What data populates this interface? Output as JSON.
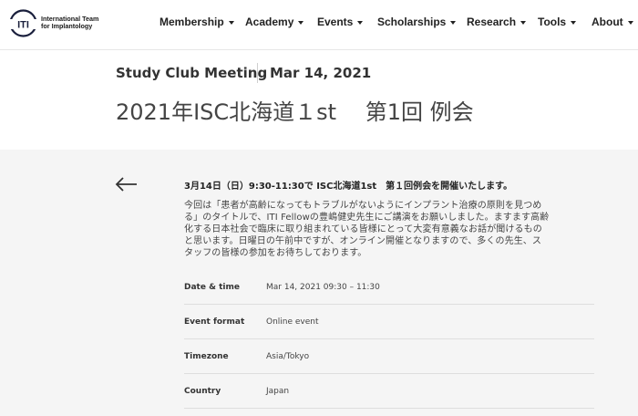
{
  "brand": {
    "mark": "ITI",
    "name_line1": "International Team",
    "name_line2": "for Implantology",
    "color": "#1a1f3c"
  },
  "nav": {
    "items": [
      {
        "label": "Membership"
      },
      {
        "label": "Academy"
      },
      {
        "label": "Events"
      },
      {
        "label": "Scholarships"
      },
      {
        "label": "Research"
      },
      {
        "label": "Tools"
      },
      {
        "label": "About"
      }
    ]
  },
  "event": {
    "type": "Study Club Meeting",
    "date": "Mar 14, 2021",
    "title": "2021年ISC北海道１st　 第1回 例会"
  },
  "body": {
    "headline": "3月14日（日）9:30-11:30で ISC北海道1st　第１回例会を開催いたします。",
    "description_lines": [
      "今回は「患者が高齢になってもトラブルがないようにインプラント治療の原則を見つめ",
      "る」のタイトルで、ITI Fellowの豊嶋健史先生にご講演をお願いしました。ますます高齢",
      "化する日本社会で臨床に取り組まれている皆様にとって大変有意義なお話が聞けるもの",
      "と思います。日曜日の午前中ですが、オンライン開催となりますので、多くの先生、ス",
      "タッフの皆様の参加をお待ちしております。"
    ]
  },
  "details": [
    {
      "label": "Date & time",
      "value": "Mar 14, 2021 09:30 – 11:30"
    },
    {
      "label": "Event format",
      "value": "Online event"
    },
    {
      "label": "Timezone",
      "value": "Asia/Tokyo"
    },
    {
      "label": "Country",
      "value": "Japan"
    }
  ],
  "colors": {
    "content_bg": "#f5f5f5",
    "divider": "#dedede"
  }
}
